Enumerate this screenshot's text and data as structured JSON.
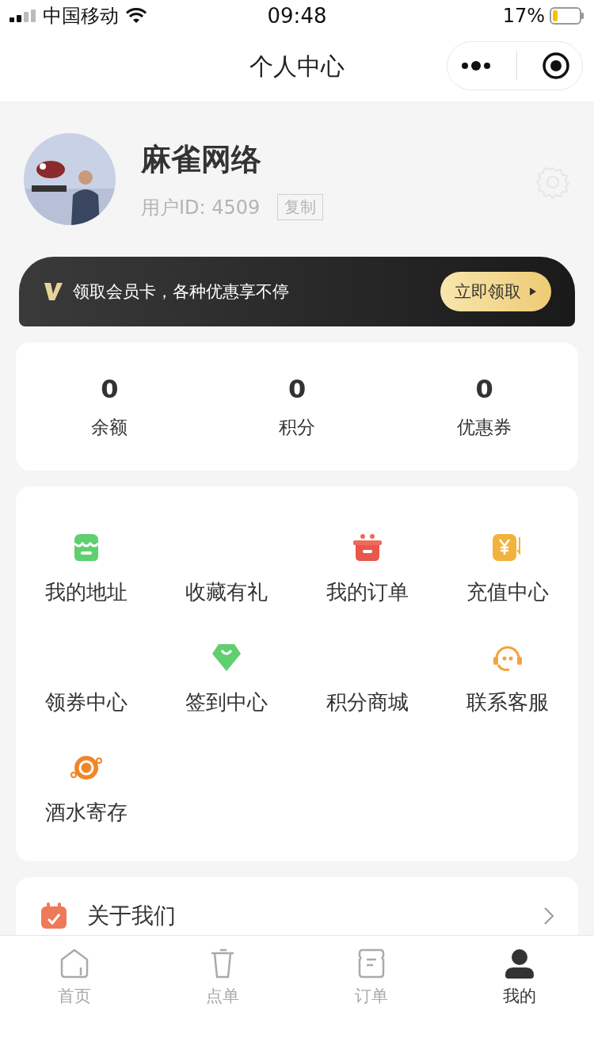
{
  "status_bar": {
    "carrier": "中国移动",
    "time": "09:48",
    "battery": "17%"
  },
  "nav": {
    "title": "个人中心"
  },
  "profile": {
    "name": "麻雀网络",
    "user_id": "用户ID: 4509",
    "copy_button": "复制"
  },
  "member_banner": {
    "text": "领取会员卡，各种优惠享不停",
    "button": "立即领取"
  },
  "stats": [
    {
      "value": "0",
      "label": "余额"
    },
    {
      "value": "0",
      "label": "积分"
    },
    {
      "value": "0",
      "label": "优惠券"
    }
  ],
  "services": [
    {
      "label": "我的地址",
      "kind": "store"
    },
    {
      "label": "收藏有礼",
      "kind": "blank"
    },
    {
      "label": "我的订单",
      "kind": "gift"
    },
    {
      "label": "充值中心",
      "kind": "coin"
    },
    {
      "label": "领券中心",
      "kind": "blank"
    },
    {
      "label": "签到中心",
      "kind": "diamond"
    },
    {
      "label": "积分商城",
      "kind": "blank"
    },
    {
      "label": "联系客服",
      "kind": "headset"
    },
    {
      "label": "酒水寄存",
      "kind": "pot"
    }
  ],
  "menu": [
    {
      "label": "关于我们"
    }
  ],
  "tab_bar": [
    {
      "label": "首页",
      "kind": "home",
      "selected": false
    },
    {
      "label": "点单",
      "kind": "cup",
      "selected": false
    },
    {
      "label": "订单",
      "kind": "order",
      "selected": false
    },
    {
      "label": "我的",
      "kind": "user",
      "selected": true
    }
  ]
}
